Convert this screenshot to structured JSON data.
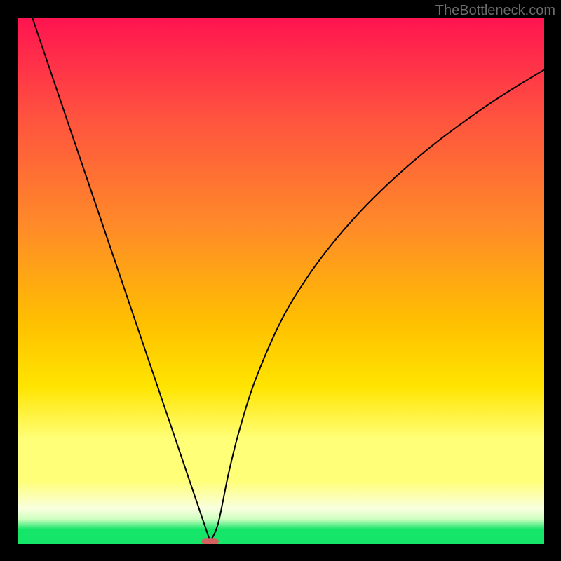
{
  "watermark": "TheBottleneck.com",
  "chart_data": {
    "type": "line",
    "title": "",
    "xlabel": "",
    "ylabel": "",
    "xlim": [
      0,
      100
    ],
    "ylim": [
      0,
      100
    ],
    "series": [
      {
        "name": "bottleneck-curve",
        "x": [
          0,
          5,
          10,
          15,
          20,
          25,
          30,
          33,
          35,
          36.5,
          38,
          40,
          42,
          45,
          50,
          55,
          60,
          65,
          70,
          75,
          80,
          85,
          90,
          95,
          100
        ],
        "y": [
          108,
          93.2,
          78.5,
          63.8,
          49.1,
          34.3,
          19.6,
          10.8,
          4.9,
          0.5,
          3.9,
          13.5,
          21.5,
          31,
          42.5,
          50.8,
          57.5,
          63.2,
          68.2,
          72.7,
          76.8,
          80.5,
          84,
          87.2,
          90.2
        ]
      }
    ],
    "marker": {
      "x": 36.5,
      "y": 0.5,
      "color": "#d46060"
    },
    "gradient_stops": [
      {
        "pos": 0,
        "color": "#ff1450"
      },
      {
        "pos": 18,
        "color": "#ff5040"
      },
      {
        "pos": 40,
        "color": "#ff8c28"
      },
      {
        "pos": 58,
        "color": "#ffc000"
      },
      {
        "pos": 70,
        "color": "#ffe400"
      },
      {
        "pos": 80,
        "color": "#ffff78"
      },
      {
        "pos": 88,
        "color": "#ffff78"
      },
      {
        "pos": 93.2,
        "color": "#f9ffdf"
      },
      {
        "pos": 95.2,
        "color": "#d0ffc0"
      },
      {
        "pos": 97.2,
        "color": "#15e569"
      },
      {
        "pos": 100,
        "color": "#15e569"
      }
    ]
  }
}
